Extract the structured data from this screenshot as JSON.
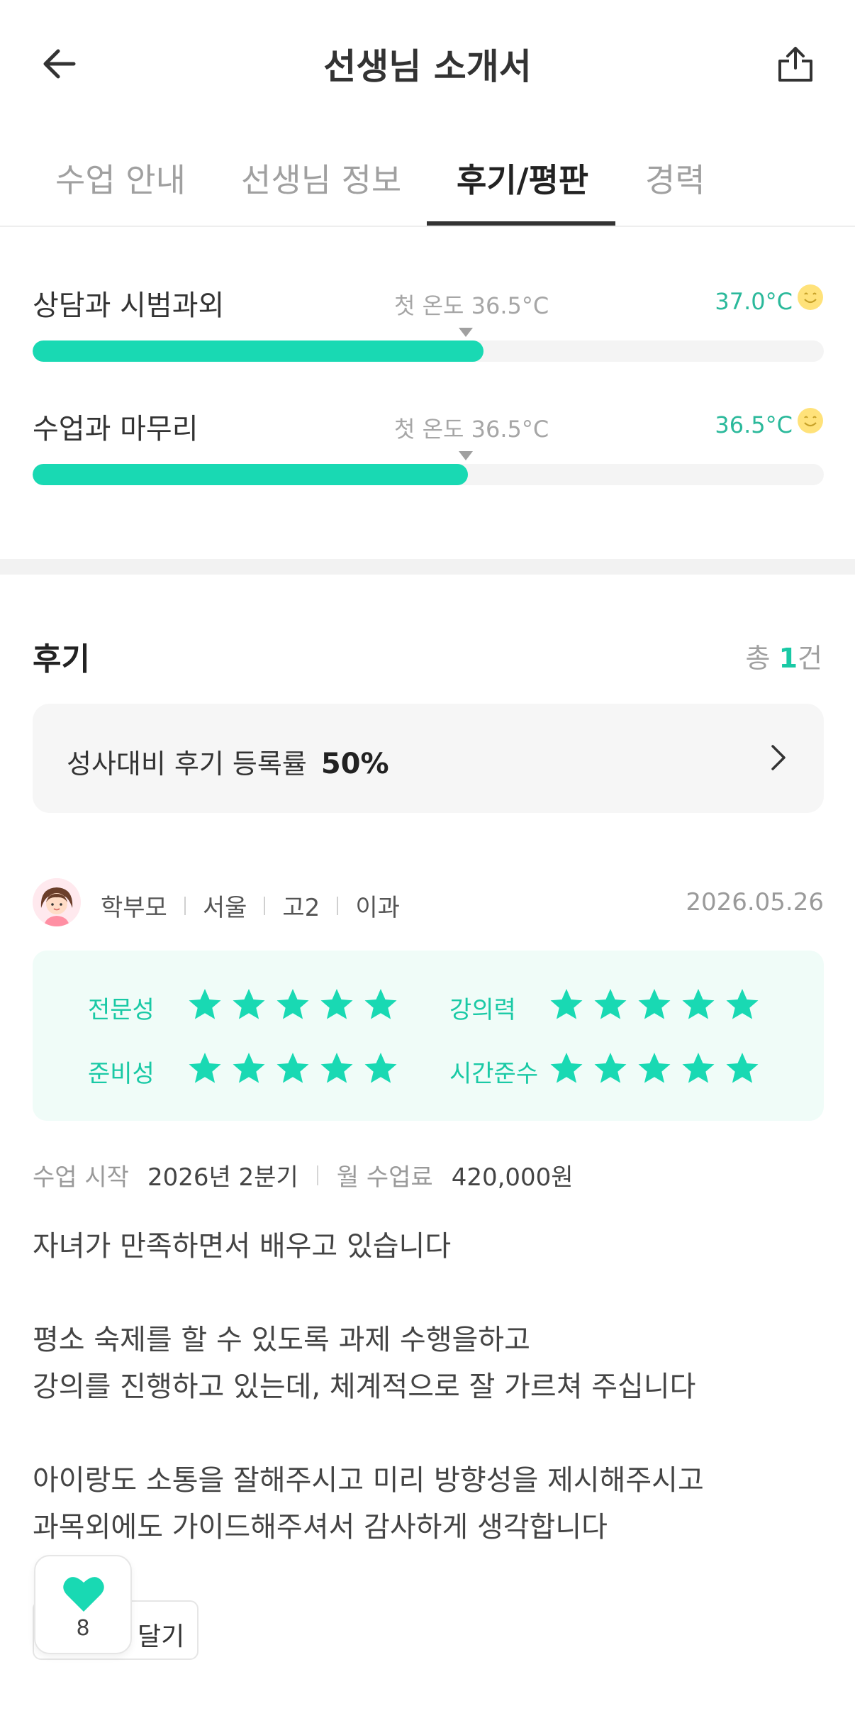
{
  "header": {
    "title": "선생님 소개서",
    "back_icon": "arrow-left-icon",
    "share_icon": "share-icon"
  },
  "tabs": [
    {
      "label": "수업 안내",
      "active": false
    },
    {
      "label": "선생님 정보",
      "active": false
    },
    {
      "label": "후기/평판",
      "active": true
    },
    {
      "label": "경력",
      "active": false
    }
  ],
  "temperature": [
    {
      "label": "상담과 시범과외",
      "first_temp_label": "첫 온도 36.5°C",
      "value": "37.0°C",
      "level": 0.57
    },
    {
      "label": "수업과 마무리",
      "first_temp_label": "첫 온도 36.5°C",
      "value": "36.5°C",
      "level": 0.55
    }
  ],
  "reviews": {
    "title": "후기",
    "total_prefix": "총 ",
    "total_count": "1",
    "total_suffix": "건",
    "registration_rate_label": "성사대비 후기 등록률",
    "registration_rate_value": "50%"
  },
  "review": {
    "author": "학부모",
    "region": "서울",
    "grade": "고2",
    "track": "이과",
    "date": "2026.05.26",
    "ratings": [
      {
        "category": "전문성",
        "stars": 5
      },
      {
        "category": "강의력",
        "stars": 5
      },
      {
        "category": "준비성",
        "stars": 5
      },
      {
        "category": "시간준수",
        "stars": 5
      }
    ],
    "start_label": "수업 시작",
    "start_value": "2026년 2분기",
    "fee_label": "월 수업료",
    "fee_value": "420,000원",
    "body": [
      "자녀가 만족하면서 배우고 있습니다",
      "",
      "평소 숙제를 할 수 있도록 과제 수행을하고",
      "강의를 진행하고 있는데, 체계적으로 잘 가르쳐 주십니다",
      "",
      "아이랑도 소통을 잘해주시고 미리 방향성을 제시해주시고",
      "과목외에도 가이드해주셔서 감사하게 생각합니다"
    ],
    "like_count": "8",
    "comment_label": "달기"
  },
  "colors": {
    "accent": "#19d9b3",
    "accent_text": "#19c9a5",
    "temp_text": "#2bb99b"
  }
}
